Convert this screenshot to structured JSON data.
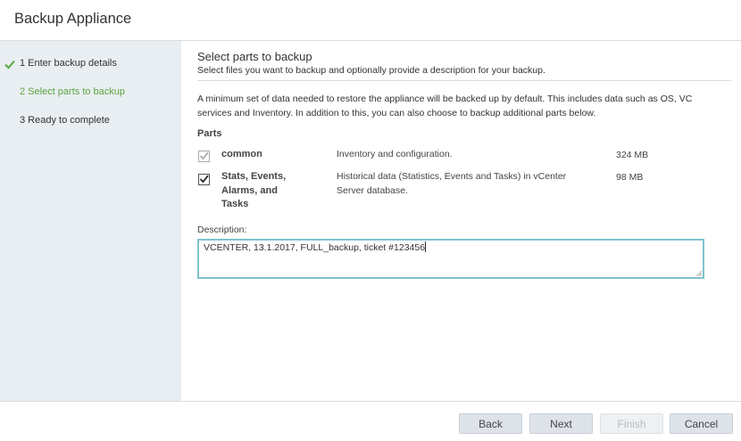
{
  "window": {
    "title": "Backup Appliance"
  },
  "steps": [
    {
      "label": "1 Enter backup details",
      "state": "done"
    },
    {
      "label": "2 Select parts to backup",
      "state": "active"
    },
    {
      "label": "3 Ready to complete",
      "state": "pending"
    }
  ],
  "page": {
    "title": "Select parts to backup",
    "subtitle": "Select files you want to backup and optionally provide a description for your backup.",
    "info_line1": "A minimum set of data needed to restore the appliance will be backed up by default. This includes data such as OS, VC",
    "info_line2": "services and Inventory. In addition to this, you can also choose to backup additional parts below.",
    "parts_label": "Parts"
  },
  "parts": [
    {
      "name": "common",
      "description": "Inventory and configuration.",
      "size": "324 MB",
      "checked": true,
      "disabled": true
    },
    {
      "name_lines": [
        "Stats, Events,",
        "Alarms, and",
        "Tasks"
      ],
      "description_lines": [
        "Historical data (Statistics, Events and Tasks) in vCenter",
        "Server database."
      ],
      "size": "98 MB",
      "checked": true,
      "disabled": false
    }
  ],
  "description": {
    "label": "Description:",
    "value": "VCENTER, 13.1.2017, FULL_backup, ticket #123456"
  },
  "buttons": {
    "back": "Back",
    "next": "Next",
    "finish": "Finish",
    "cancel": "Cancel"
  },
  "colors": {
    "accent_green": "#5aa63d",
    "focus_border": "#7fc3cf",
    "sidebar_bg": "#e9eef2"
  },
  "icons": {
    "done_step": "check-icon",
    "checkbox_checked": "checkmark-icon",
    "textarea_resize": "resize-grip-icon"
  }
}
